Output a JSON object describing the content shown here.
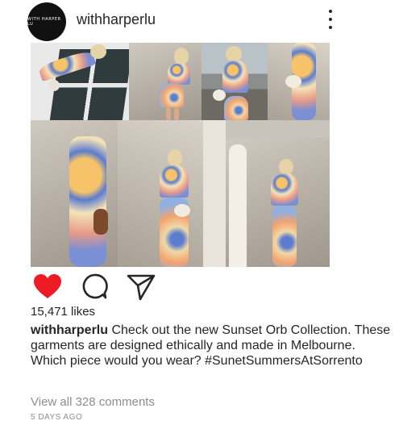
{
  "post": {
    "avatar_text": "WITH HARPER LU",
    "username": "withharperlu",
    "likes": "15,471 likes",
    "caption_user": "withharperlu",
    "caption_text": " Check out the new Sunset Orb Collection. These garments are designed ethically and made in Melbourne. Which piece would you wear? #SunetSummersAtSorrento",
    "view_comments": "View all 328 comments",
    "time_ago": "5 DAYS AGO"
  },
  "icons": {
    "like": "heart-icon",
    "comment": "comment-icon",
    "share": "send-icon",
    "more": "more-vertical-icon"
  },
  "colors": {
    "like_red": "#ed1c24",
    "text": "#262626",
    "muted": "#8e8e8e"
  }
}
